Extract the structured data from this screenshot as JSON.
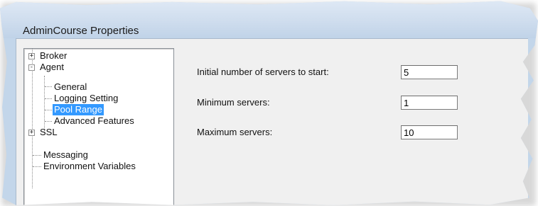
{
  "window": {
    "title": "AdminCourse Properties"
  },
  "tree": {
    "nodes": [
      {
        "label": "Broker",
        "expander": "+"
      },
      {
        "label": "Agent",
        "expander": "-"
      },
      {
        "label": "General"
      },
      {
        "label": "Logging Setting"
      },
      {
        "label": "Pool Range",
        "selected": true
      },
      {
        "label": "Advanced Features"
      },
      {
        "label": "SSL",
        "expander": "+"
      },
      {
        "label": "Messaging"
      },
      {
        "label": "Environment Variables"
      }
    ]
  },
  "fields": [
    {
      "label": "Initial number of servers to start:",
      "value": "5"
    },
    {
      "label": "Minimum servers:",
      "value": "1"
    },
    {
      "label": "Maximum servers:",
      "value": "10"
    }
  ],
  "colors": {
    "selection": "#3399ff",
    "title_bar": "#cfddee",
    "panel": "#f0f0f0"
  }
}
